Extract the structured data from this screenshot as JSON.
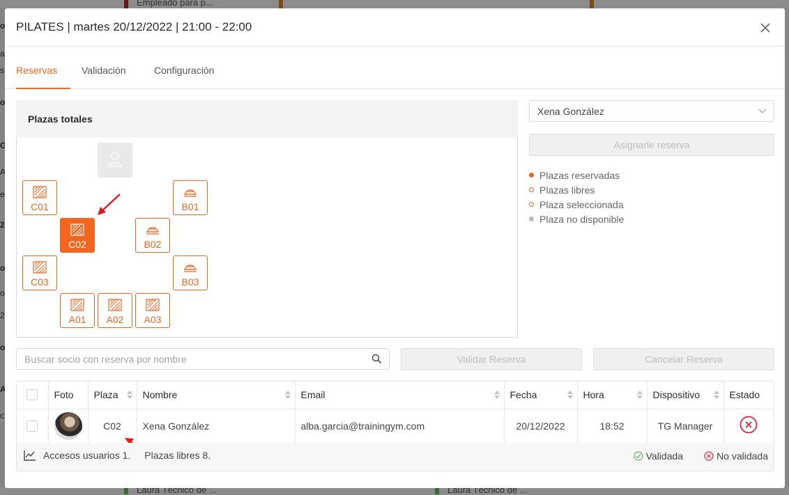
{
  "background": {
    "top_text": "Empleado para p...",
    "bottom_left_text": "Laura Técnico de ...",
    "bottom_right_text": "Laura Técnico de ...",
    "side_letters": [
      "o",
      "a",
      "s",
      "o",
      "G",
      "A",
      "e",
      "2",
      "o",
      "o",
      "2",
      "o",
      "A",
      "c"
    ]
  },
  "modal": {
    "title": "PILATES | martes 20/12/2022 | 21:00 - 22:00",
    "close_icon": "close-icon"
  },
  "tabs": [
    {
      "label": "Reservas",
      "active": true
    },
    {
      "label": "Validación",
      "active": false
    },
    {
      "label": "Configuración",
      "active": false
    }
  ],
  "plazas": {
    "title": "Plazas totales",
    "seats": [
      {
        "code": "C01",
        "icon": "mat-icon",
        "selected": false
      },
      {
        "code": "C02",
        "icon": "mat-icon",
        "selected": true
      },
      {
        "code": "C03",
        "icon": "mat-icon",
        "selected": false
      },
      {
        "code": "B01",
        "icon": "reformer-icon",
        "selected": false
      },
      {
        "code": "B02",
        "icon": "reformer-icon",
        "selected": false
      },
      {
        "code": "B03",
        "icon": "reformer-icon",
        "selected": false
      },
      {
        "code": "A01",
        "icon": "mat-icon",
        "selected": false
      },
      {
        "code": "A02",
        "icon": "mat-icon",
        "selected": false
      },
      {
        "code": "A03",
        "icon": "mat-icon",
        "selected": false
      }
    ]
  },
  "member_select": {
    "value": "Xena González"
  },
  "assign_button": "Asignarle reserva",
  "legend": [
    {
      "label": "Plazas reservadas",
      "color": "#f2661f",
      "style": "filled"
    },
    {
      "label": "Plazas libres",
      "color": "#f2661f",
      "style": "outline"
    },
    {
      "label": "Plaza seleccionada",
      "color": "#f2661f",
      "style": "outline"
    },
    {
      "label": "Plaza no disponible",
      "color": "#bdbdbd",
      "style": "filled"
    }
  ],
  "search": {
    "placeholder": "Buscar socio con reserva por nombre",
    "value": ""
  },
  "buttons": {
    "validate": "Validar Reserva",
    "cancel": "Cancelar Reserva"
  },
  "table": {
    "headers": [
      "Foto",
      "Plaza",
      "Nombre",
      "Email",
      "Fecha",
      "Hora",
      "Dispositivo",
      "Estado"
    ],
    "rows": [
      {
        "plaza": "C02",
        "nombre": "Xena González",
        "email": "alba.garcia@trainingym.com",
        "fecha": "20/12/2022",
        "hora": "18:52",
        "dispositivo": "TG Manager",
        "estado": "no-validada"
      }
    ],
    "footer": {
      "accesos": "Accesos usuarios 1.",
      "plazas_libres": "Plazas libres 8.",
      "validada": "Validada",
      "no_validada": "No validada"
    }
  },
  "colors": {
    "accent": "#f2661f",
    "error": "#e0243a",
    "success": "#5cb85c"
  }
}
